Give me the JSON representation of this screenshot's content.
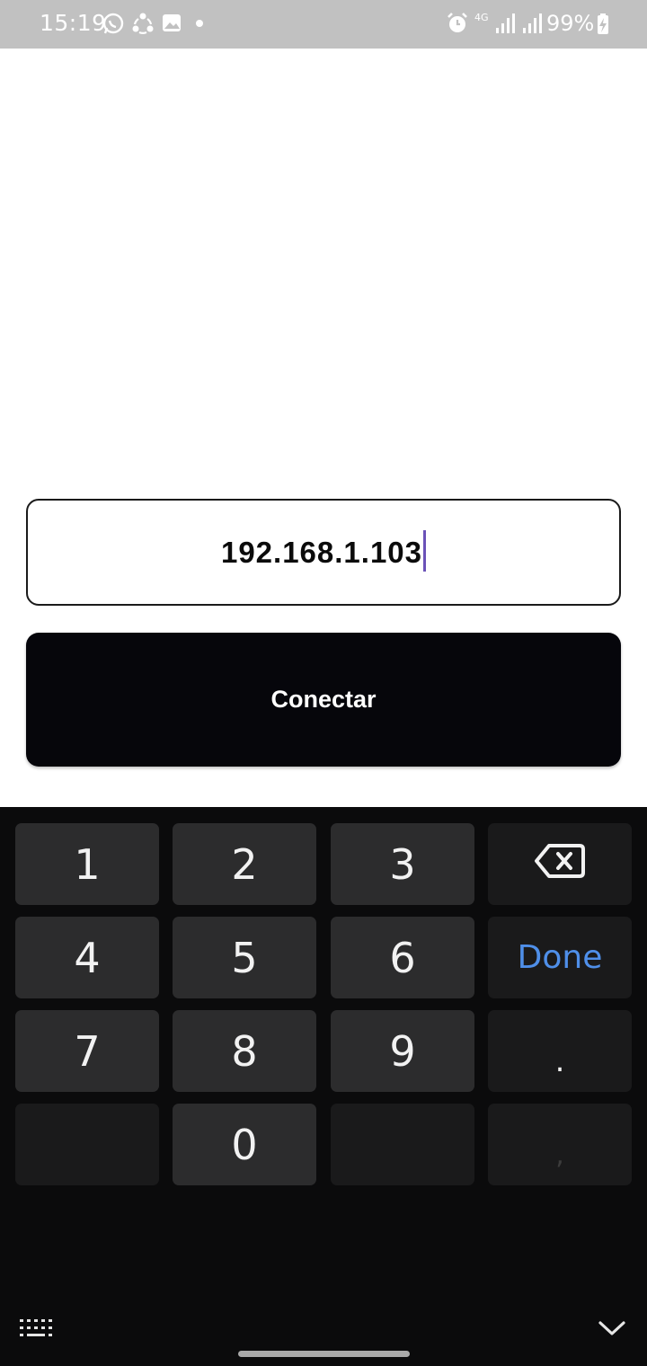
{
  "status_bar": {
    "time": "15:19",
    "battery": "99%",
    "network": "4G",
    "icons": [
      "whatsapp-icon",
      "sync-icon",
      "gallery-icon",
      "notification-dot",
      "alarm-icon",
      "signal-icon",
      "signal-icon",
      "battery-charging-icon"
    ]
  },
  "form": {
    "ip_value": "192.168.1.103",
    "connect_label": "Conectar"
  },
  "keyboard": {
    "keys": [
      [
        "1",
        "2",
        "3",
        "backspace"
      ],
      [
        "4",
        "5",
        "6",
        "Done"
      ],
      [
        "7",
        "8",
        "9",
        "."
      ],
      [
        "",
        "0",
        "",
        ","
      ]
    ],
    "done_label": "Done",
    "colors": {
      "done": "#4f8fe9",
      "key_bg": "#2c2c2d",
      "func_key_bg": "#1a1a1b",
      "keyboard_bg": "#0b0b0c"
    }
  },
  "colors": {
    "status_bar_bg": "#c1c1c1",
    "button_bg": "#06060b",
    "caret": "#6b52b8"
  }
}
